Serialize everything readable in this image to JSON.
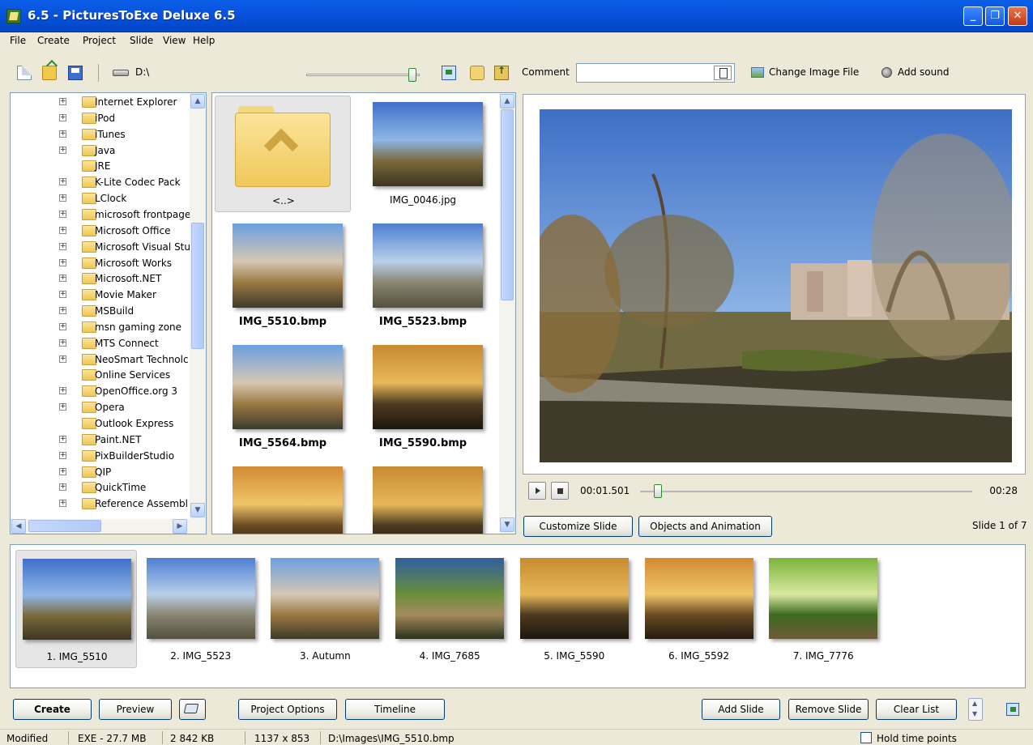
{
  "window": {
    "title": "6.5 - PicturesToExe Deluxe 6.5"
  },
  "menu": [
    "File",
    "Create",
    "Project",
    "Slide",
    "View",
    "Help"
  ],
  "toolbar": {
    "drive": "D:\\",
    "zoom_level": 0.9,
    "comment_label": "Comment",
    "comment_value": "",
    "change_image": "Change Image File",
    "add_sound": "Add sound"
  },
  "folder_tree": {
    "items": [
      "Internet Explorer",
      "iPod",
      "iTunes",
      "Java",
      "JRE",
      "K-Lite Codec Pack",
      "LClock",
      "microsoft frontpage",
      "Microsoft Office",
      "Microsoft Visual Stu",
      "Microsoft Works",
      "Microsoft.NET",
      "Movie Maker",
      "MSBuild",
      "msn gaming zone",
      "MTS Connect",
      "NeoSmart Technolc",
      "Online Services",
      "OpenOffice.org 3",
      "Opera",
      "Outlook Express",
      "Paint.NET",
      "PixBuilderStudio",
      "QIP",
      "QuickTime",
      "Reference Assembl"
    ],
    "no_expander": [
      4,
      17,
      20
    ]
  },
  "file_grid": {
    "items": [
      {
        "name": "<..>",
        "bold": false,
        "kind": "folder"
      },
      {
        "name": "IMG_0046.jpg",
        "bold": false,
        "kind": "image"
      },
      {
        "name": "IMG_5510.bmp",
        "bold": true,
        "kind": "image"
      },
      {
        "name": "IMG_5523.bmp",
        "bold": true,
        "kind": "image"
      },
      {
        "name": "IMG_5564.bmp",
        "bold": true,
        "kind": "image"
      },
      {
        "name": "IMG_5590.bmp",
        "bold": true,
        "kind": "image"
      },
      {
        "name": "",
        "bold": false,
        "kind": "image"
      },
      {
        "name": "",
        "bold": false,
        "kind": "image"
      }
    ]
  },
  "player": {
    "time": "00:01.501",
    "end": "00:28",
    "progress": 0.054
  },
  "slide_buttons": {
    "customize": "Customize Slide",
    "objects": "Objects and Animation",
    "count": "Slide 1 of 7"
  },
  "slides": [
    "1. IMG_5510",
    "2. IMG_5523",
    "3. Autumn",
    "4. IMG_7685",
    "5. IMG_5590",
    "6. IMG_5592",
    "7. IMG_7776"
  ],
  "bottom": {
    "create": "Create",
    "preview": "Preview",
    "project_options": "Project Options",
    "timeline": "Timeline",
    "add_slide": "Add Slide",
    "remove_slide": "Remove Slide",
    "clear_list": "Clear List"
  },
  "status": {
    "state": "Modified",
    "exe": "EXE - 27.7 MB",
    "kb": "2 842 KB",
    "dims": "1137 x 853",
    "path": "D:\\Images\\IMG_5510.bmp",
    "hold": "Hold time points"
  }
}
